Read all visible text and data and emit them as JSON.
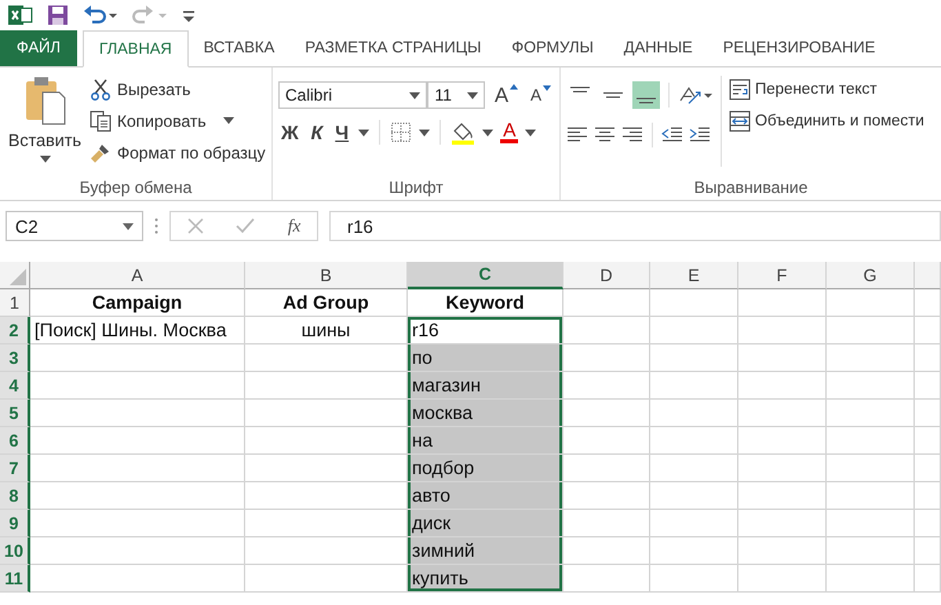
{
  "ribbon_tabs": [
    {
      "label": "ФАЙЛ",
      "kind": "file",
      "selected": false
    },
    {
      "label": "ГЛАВНАЯ",
      "kind": "tab",
      "selected": true
    },
    {
      "label": "ВСТАВКА",
      "kind": "tab",
      "selected": false
    },
    {
      "label": "РАЗМЕТКА СТРАНИЦЫ",
      "kind": "tab",
      "selected": false
    },
    {
      "label": "ФОРМУЛЫ",
      "kind": "tab",
      "selected": false
    },
    {
      "label": "ДАННЫЕ",
      "kind": "tab",
      "selected": false
    },
    {
      "label": "РЕЦЕНЗИРОВАНИЕ",
      "kind": "tab",
      "selected": false
    }
  ],
  "clipboard": {
    "paste": "Вставить",
    "cut": "Вырезать",
    "copy": "Копировать",
    "format_painter": "Формат по образцу",
    "label": "Буфер обмена"
  },
  "font": {
    "name": "Calibri",
    "size": "11",
    "grow": "A",
    "shrink": "A",
    "bold": "Ж",
    "italic": "К",
    "underline": "Ч",
    "color_letter": "A",
    "label": "Шрифт"
  },
  "alignment": {
    "vertical_buttons": [
      {
        "selected": false
      },
      {
        "selected": false
      },
      {
        "selected": true
      }
    ],
    "wrap_text": "Перенести текст",
    "merge": "Объединить и помести",
    "label": "Выравнивание"
  },
  "formula_bar": {
    "name_box": "C2",
    "fx": "fx",
    "value": "r16"
  },
  "sheet": {
    "columns": [
      {
        "label": "A",
        "selected": false
      },
      {
        "label": "B",
        "selected": false
      },
      {
        "label": "C",
        "selected": true
      },
      {
        "label": "D",
        "selected": false
      },
      {
        "label": "E",
        "selected": false
      },
      {
        "label": "F",
        "selected": false
      },
      {
        "label": "G",
        "selected": false
      }
    ],
    "rows": [
      {
        "label": "1",
        "selected": false,
        "cells": [
          {
            "text": "Campaign",
            "bold": true,
            "centered": true,
            "selected": false
          },
          {
            "text": "Ad Group",
            "bold": true,
            "centered": true,
            "selected": false
          },
          {
            "text": "Keyword",
            "bold": true,
            "centered": true,
            "selected": false
          }
        ]
      },
      {
        "label": "2",
        "selected": true,
        "cells": [
          {
            "text": "[Поиск] Шины. Москва",
            "selected": false
          },
          {
            "text": "шины",
            "centered": true,
            "selected": false
          },
          {
            "text": "r16",
            "selected": true
          }
        ]
      },
      {
        "label": "3",
        "selected": true,
        "cells": [
          {
            "selected": false
          },
          {
            "selected": false
          },
          {
            "text": "по",
            "selected": true
          }
        ]
      },
      {
        "label": "4",
        "selected": true,
        "cells": [
          {
            "selected": false
          },
          {
            "selected": false
          },
          {
            "text": "магазин",
            "selected": true
          }
        ]
      },
      {
        "label": "5",
        "selected": true,
        "cells": [
          {
            "selected": false
          },
          {
            "selected": false
          },
          {
            "text": "москва",
            "selected": true
          }
        ]
      },
      {
        "label": "6",
        "selected": true,
        "cells": [
          {
            "selected": false
          },
          {
            "selected": false
          },
          {
            "text": "на",
            "selected": true
          }
        ]
      },
      {
        "label": "7",
        "selected": true,
        "cells": [
          {
            "selected": false
          },
          {
            "selected": false
          },
          {
            "text": "подбор",
            "selected": true
          }
        ]
      },
      {
        "label": "8",
        "selected": true,
        "cells": [
          {
            "selected": false
          },
          {
            "selected": false
          },
          {
            "text": "авто",
            "selected": true
          }
        ]
      },
      {
        "label": "9",
        "selected": true,
        "cells": [
          {
            "selected": false
          },
          {
            "selected": false
          },
          {
            "text": "диск",
            "selected": true
          }
        ]
      },
      {
        "label": "10",
        "selected": true,
        "cells": [
          {
            "selected": false
          },
          {
            "selected": false
          },
          {
            "text": "зимний",
            "selected": true
          }
        ]
      },
      {
        "label": "11",
        "selected": true,
        "cells": [
          {
            "selected": false
          },
          {
            "selected": false
          },
          {
            "text": "купить",
            "selected": true
          }
        ]
      }
    ]
  }
}
